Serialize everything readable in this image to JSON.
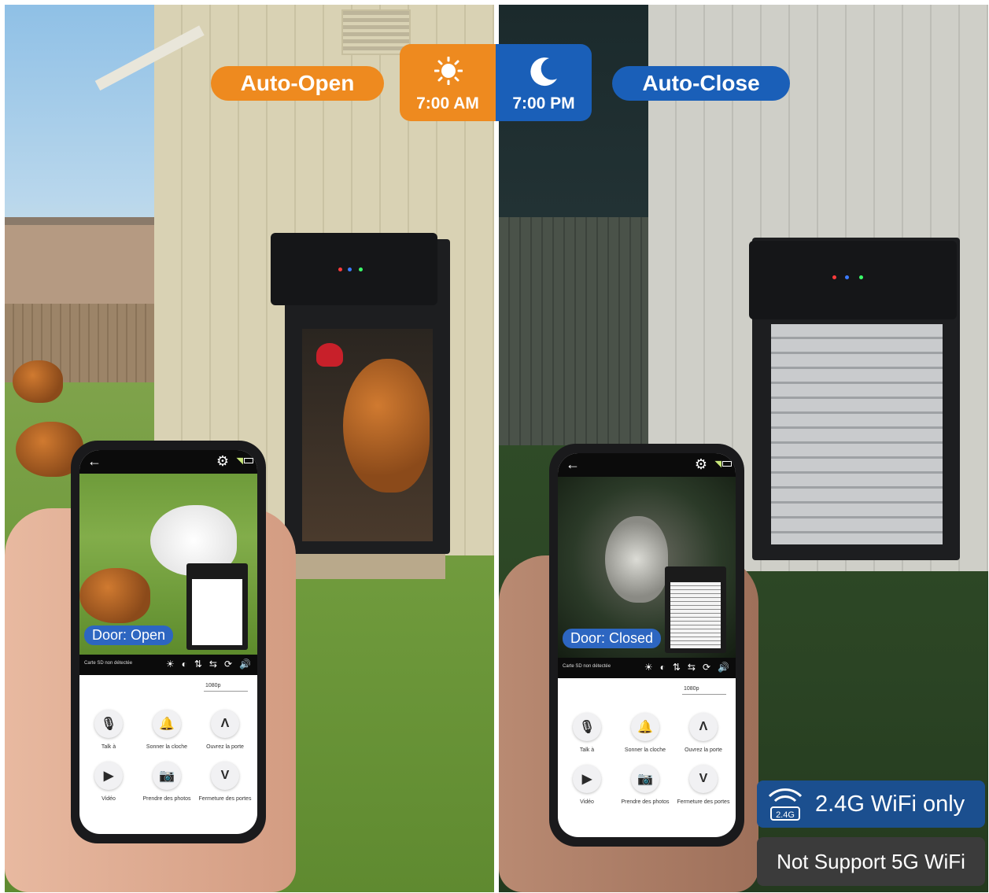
{
  "badges": {
    "auto_open": "Auto-Open",
    "auto_close": "Auto-Close",
    "open_time": "7:00 AM",
    "close_time": "7:00 PM"
  },
  "wifi": {
    "band_icon_label": "2.4G",
    "only_text": "2.4G WiFi only",
    "not_support_text": "Not Support 5G WiFi"
  },
  "phones": {
    "left": {
      "door_status": "Door: Open",
      "sd_status": "Carte SD non détectée",
      "resolution": "1080p",
      "controls": [
        {
          "label": "Talk à",
          "icon": "microphone-icon",
          "glyph": "🎙"
        },
        {
          "label": "Sonner la cloche",
          "icon": "bell-icon",
          "glyph": "🔔"
        },
        {
          "label": "Ouvrez la porte",
          "icon": "chevron-up-icon",
          "glyph": "Λ"
        },
        {
          "label": "Vidéo",
          "icon": "video-icon",
          "glyph": "▶"
        },
        {
          "label": "Prendre des photos",
          "icon": "camera-icon",
          "glyph": "📷"
        },
        {
          "label": "Fermeture des portes",
          "icon": "chevron-down-icon",
          "glyph": "V"
        }
      ]
    },
    "right": {
      "door_status": "Door: Closed",
      "sd_status": "Carte SD non détectée",
      "resolution": "1080p",
      "controls": [
        {
          "label": "Talk à",
          "icon": "microphone-icon",
          "glyph": "🎙"
        },
        {
          "label": "Sonner la cloche",
          "icon": "bell-icon",
          "glyph": "🔔"
        },
        {
          "label": "Ouvrez la porte",
          "icon": "chevron-up-icon",
          "glyph": "Λ"
        },
        {
          "label": "Vidéo",
          "icon": "video-icon",
          "glyph": "▶"
        },
        {
          "label": "Prendre des photos",
          "icon": "camera-icon",
          "glyph": "📷"
        },
        {
          "label": "Fermeture des portes",
          "icon": "chevron-down-icon",
          "glyph": "V"
        }
      ]
    }
  },
  "colors": {
    "orange": "#ee8a1f",
    "blue": "#1a5fb8",
    "door_status_blue": "#2d66c1",
    "wifi_badge": "#1b4f8f",
    "no5g_badge": "#3b3b3b"
  }
}
